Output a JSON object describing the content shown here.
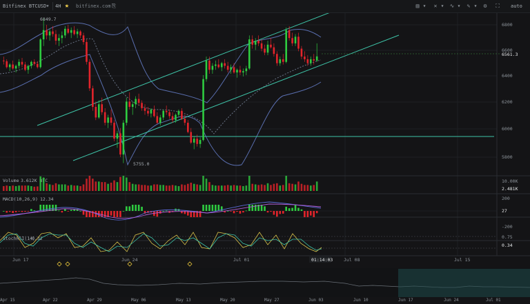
{
  "toolbar": {
    "symbol": "Bitfinex BTCUSD",
    "timeframe": "4H",
    "watermark": "bitfinex.com",
    "auto_label": "auto",
    "accent": "#f5d142"
  },
  "price_pane": {
    "price_axis_ticks": [
      "6800",
      "6600",
      "6400",
      "6200",
      "6000",
      "5800"
    ],
    "current_price_label": "6561.3",
    "high_annotation": "6849.7",
    "low_annotation": "5755.0"
  },
  "volume_pane": {
    "label": "Volume",
    "value": "3.612K BTC",
    "axis_ticks": [
      "10.00K",
      "2.481K"
    ]
  },
  "macd_pane": {
    "label": "MACD(10,26,9)",
    "value": "12.34",
    "axis_ticks": [
      "200",
      "27",
      "-200"
    ]
  },
  "stochrsi_pane": {
    "label": "StochRSI(14)",
    "value": "0.32",
    "axis_ticks": [
      "0.75",
      "0.34"
    ]
  },
  "time_axis": {
    "labels": [
      "Jun 17",
      "Jun 24",
      "Jul 01",
      "Jul 08",
      "Jul 15"
    ],
    "countdown": "01:14:03"
  },
  "navigator": {
    "labels": [
      "Apr 15",
      "Apr 22",
      "Apr 29",
      "May 06",
      "May 13",
      "May 20",
      "May 27",
      "Jun 03",
      "Jun 10",
      "Jun 17",
      "Jun 24",
      "Jul 01"
    ]
  },
  "colors": {
    "up": "#2ecc40",
    "down": "#e3242b",
    "channel": "#3ec4a8",
    "bollinger": "#5a6fb0",
    "grid": "#1e2024",
    "background": "#141416"
  },
  "chart_data": {
    "type": "candlestick",
    "ohlc": [
      [
        6530,
        6560,
        6500,
        6525
      ],
      [
        6525,
        6540,
        6470,
        6480
      ],
      [
        6480,
        6510,
        6450,
        6500
      ],
      [
        6500,
        6530,
        6460,
        6470
      ],
      [
        6470,
        6500,
        6440,
        6490
      ],
      [
        6490,
        6540,
        6470,
        6520
      ],
      [
        6520,
        6550,
        6480,
        6500
      ],
      [
        6500,
        6520,
        6450,
        6460
      ],
      [
        6460,
        6500,
        6430,
        6490
      ],
      [
        6490,
        6530,
        6470,
        6520
      ],
      [
        6520,
        6540,
        6490,
        6505
      ],
      [
        6505,
        6525,
        6470,
        6480
      ],
      [
        6480,
        6700,
        6470,
        6690
      ],
      [
        6690,
        6849.7,
        6640,
        6760
      ],
      [
        6760,
        6800,
        6690,
        6720
      ],
      [
        6720,
        6770,
        6680,
        6750
      ],
      [
        6750,
        6790,
        6710,
        6730
      ],
      [
        6730,
        6760,
        6650,
        6680
      ],
      [
        6680,
        6730,
        6640,
        6700
      ],
      [
        6700,
        6750,
        6660,
        6720
      ],
      [
        6720,
        6790,
        6700,
        6770
      ],
      [
        6770,
        6800,
        6730,
        6740
      ],
      [
        6740,
        6780,
        6700,
        6760
      ],
      [
        6760,
        6790,
        6720,
        6730
      ],
      [
        6730,
        6770,
        6700,
        6750
      ],
      [
        6750,
        6760,
        6700,
        6720
      ],
      [
        6720,
        6740,
        6650,
        6670
      ],
      [
        6670,
        6690,
        6500,
        6520
      ],
      [
        6520,
        6540,
        6300,
        6320
      ],
      [
        6320,
        6340,
        6150,
        6180
      ],
      [
        6180,
        6220,
        6080,
        6100
      ],
      [
        6100,
        6230,
        6090,
        6200
      ],
      [
        6200,
        6250,
        6120,
        6140
      ],
      [
        6140,
        6170,
        6040,
        6060
      ],
      [
        6060,
        6120,
        6020,
        6100
      ],
      [
        6100,
        6160,
        6040,
        6060
      ],
      [
        6060,
        6080,
        5920,
        5940
      ],
      [
        5940,
        6000,
        5870,
        5980
      ],
      [
        5980,
        6020,
        5800,
        5820
      ],
      [
        5820,
        6080,
        5755,
        6060
      ],
      [
        6060,
        6250,
        6040,
        6220
      ],
      [
        6220,
        6290,
        6160,
        6180
      ],
      [
        6180,
        6220,
        6120,
        6200
      ],
      [
        6200,
        6260,
        6170,
        6240
      ],
      [
        6240,
        6280,
        6190,
        6210
      ],
      [
        6210,
        6230,
        6150,
        6170
      ],
      [
        6170,
        6200,
        6120,
        6150
      ],
      [
        6150,
        6180,
        6110,
        6130
      ],
      [
        6130,
        6170,
        6100,
        6160
      ],
      [
        6160,
        6190,
        6100,
        6110
      ],
      [
        6110,
        6140,
        6050,
        6060
      ],
      [
        6060,
        6120,
        6040,
        6100
      ],
      [
        6100,
        6160,
        6080,
        6150
      ],
      [
        6150,
        6190,
        6120,
        6140
      ],
      [
        6140,
        6160,
        6090,
        6110
      ],
      [
        6110,
        6140,
        6060,
        6080
      ],
      [
        6080,
        6130,
        6060,
        6120
      ],
      [
        6120,
        6160,
        6100,
        6150
      ],
      [
        6150,
        6170,
        6080,
        6090
      ],
      [
        6090,
        6120,
        6040,
        6060
      ],
      [
        6060,
        6080,
        5980,
        5990
      ],
      [
        5990,
        6020,
        5900,
        5910
      ],
      [
        5910,
        5960,
        5860,
        5940
      ],
      [
        5940,
        5970,
        5880,
        5900
      ],
      [
        5900,
        5950,
        5870,
        5930
      ],
      [
        5930,
        6420,
        5920,
        6390
      ],
      [
        6390,
        6560,
        6370,
        6530
      ],
      [
        6530,
        6560,
        6430,
        6460
      ],
      [
        6460,
        6510,
        6430,
        6490
      ],
      [
        6490,
        6530,
        6460,
        6500
      ],
      [
        6500,
        6540,
        6470,
        6480
      ],
      [
        6480,
        6520,
        6450,
        6510
      ],
      [
        6510,
        6540,
        6470,
        6490
      ],
      [
        6490,
        6520,
        6440,
        6460
      ],
      [
        6460,
        6500,
        6430,
        6480
      ],
      [
        6480,
        6510,
        6430,
        6440
      ],
      [
        6440,
        6470,
        6400,
        6460
      ],
      [
        6460,
        6490,
        6420,
        6440
      ],
      [
        6440,
        6470,
        6410,
        6450
      ],
      [
        6450,
        6490,
        6420,
        6470
      ],
      [
        6470,
        6720,
        6460,
        6690
      ],
      [
        6690,
        6720,
        6620,
        6650
      ],
      [
        6650,
        6700,
        6610,
        6680
      ],
      [
        6680,
        6720,
        6640,
        6660
      ],
      [
        6660,
        6690,
        6600,
        6620
      ],
      [
        6620,
        6650,
        6570,
        6590
      ],
      [
        6590,
        6680,
        6570,
        6650
      ],
      [
        6650,
        6700,
        6620,
        6630
      ],
      [
        6630,
        6660,
        6560,
        6580
      ],
      [
        6580,
        6600,
        6490,
        6510
      ],
      [
        6510,
        6560,
        6490,
        6540
      ],
      [
        6540,
        6580,
        6500,
        6520
      ],
      [
        6520,
        6780,
        6510,
        6760
      ],
      [
        6760,
        6790,
        6680,
        6700
      ],
      [
        6700,
        6740,
        6640,
        6660
      ],
      [
        6660,
        6730,
        6640,
        6710
      ],
      [
        6710,
        6740,
        6600,
        6620
      ],
      [
        6620,
        6640,
        6540,
        6560
      ],
      [
        6560,
        6600,
        6520,
        6540
      ],
      [
        6540,
        6570,
        6490,
        6510
      ],
      [
        6510,
        6560,
        6490,
        6540
      ],
      [
        6540,
        6580,
        6500,
        6530
      ],
      [
        6530,
        6660,
        6520,
        6561.3
      ]
    ]
  }
}
